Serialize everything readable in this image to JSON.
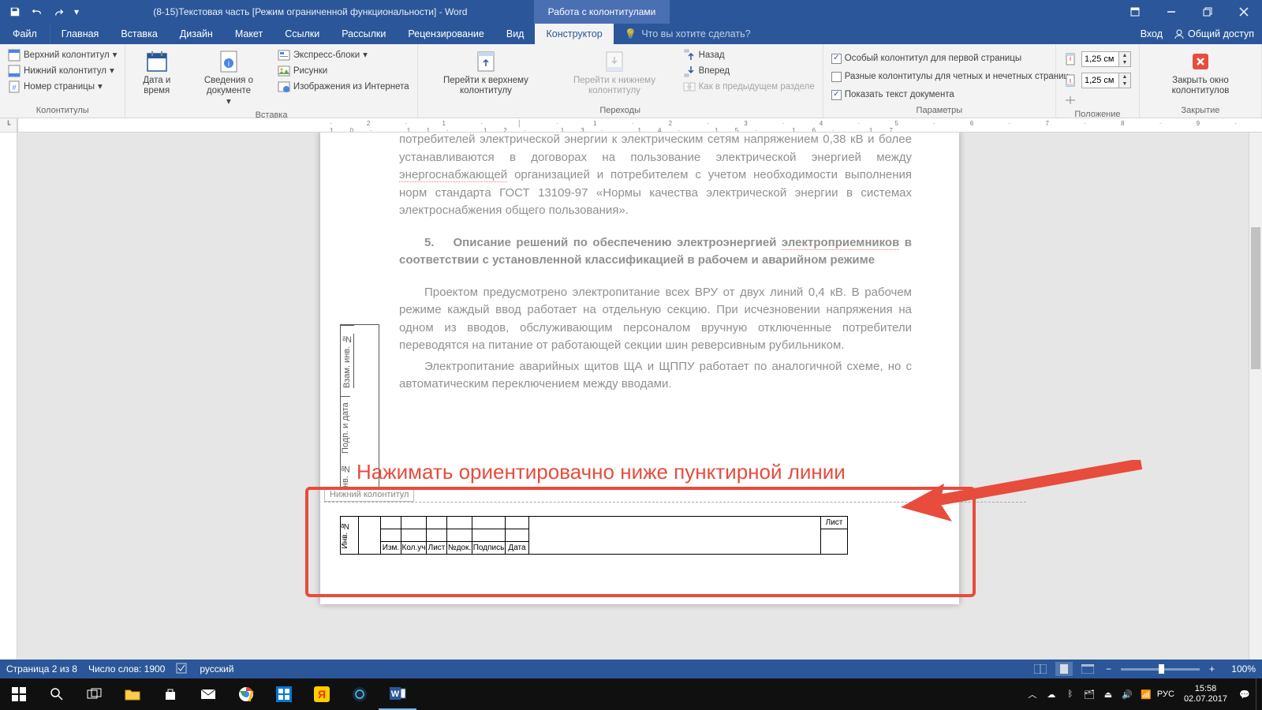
{
  "titlebar": {
    "doc_title": "(8-15)Текстовая часть [Режим ограниченной функциональности] - Word",
    "tool_tab": "Работа с колонтитулами"
  },
  "tabs": {
    "file": "Файл",
    "items": [
      "Главная",
      "Вставка",
      "Дизайн",
      "Макет",
      "Ссылки",
      "Рассылки",
      "Рецензирование",
      "Вид",
      "Конструктор"
    ],
    "active": "Конструктор",
    "tell_me": "Что вы хотите сделать?",
    "sign_in": "Вход",
    "share": "Общий доступ"
  },
  "ribbon": {
    "g1": {
      "header_top": "Верхний колонтитул",
      "header_bot": "Нижний колонтитул",
      "page_num": "Номер страницы",
      "label": "Колонтитулы"
    },
    "g2": {
      "date": "Дата и время",
      "docinfo": "Сведения о документе",
      "express": "Экспресс-блоки",
      "pictures": "Рисунки",
      "online_pics": "Изображения из Интернета",
      "label": "Вставка"
    },
    "g3": {
      "goto_header": "Перейти к верхнему колонтитулу",
      "goto_footer": "Перейти к нижнему колонтитулу",
      "prev": "Назад",
      "next": "Вперед",
      "link_prev": "Как в предыдущем разделе",
      "label": "Переходы"
    },
    "g4": {
      "diff_first": "Особый колонтитул для первой страницы",
      "diff_odd": "Разные колонтитулы для четных и нечетных страниц",
      "show_doc": "Показать текст документа",
      "label": "Параметры"
    },
    "g5": {
      "top_val": "1,25 см",
      "bot_val": "1,25 см",
      "label": "Положение"
    },
    "g6": {
      "close": "Закрыть окно колонтитулов",
      "label": "Закрытие"
    }
  },
  "document": {
    "para1_a": "потребителей электрической энергии к электрическим сетям напряжением 0,38 кВ и более устанавливаются в договорах на пользование электрической энергией между ",
    "para1_u": "энергоснабжающей",
    "para1_b": " организацией и потребителем с учетом необходимости выполнения норм стандарта ГОСТ 13109-97 «Нормы качества электрической энергии в системах электроснабжения общего пользования».",
    "heading_num": "5.",
    "heading_a": "Описание решений по обеспечению электроэнергией ",
    "heading_u": "электроприемников",
    "heading_b": " в соответствии с установленной классификацией в рабочем и аварийном режиме",
    "para3": "Проектом предусмотрено электропитание всех ВРУ от двух линий 0,4 кВ. В рабочем режиме каждый ввод работает на отдельную секцию. При исчезновении напряжения на одном из вводов, обслуживающим персоналом вручную отключенные потребители переводятся на питание от работающей секции шин реверсивным рубильником.",
    "para4": "Электропитание аварийных щитов ЩА и ЩППУ работает по аналогичной схеме, но с автоматическим переключением между вводами.",
    "side_labels": [
      "Взам. инв. №",
      "Подп. и дата",
      "Инв. №"
    ],
    "footer_tag": "Нижний колонтитул",
    "stamp_headers": [
      "Изм.",
      "Кол.уч",
      "Лист",
      "№док.",
      "Подпись",
      "Дата"
    ],
    "stamp_right": "Лист"
  },
  "annotation": {
    "text": "Нажимать ориентировачно ниже пунктирной линии"
  },
  "statusbar": {
    "page": "Страница 2 из 8",
    "words": "Число слов: 1900",
    "lang": "русский",
    "zoom": "100%"
  },
  "taskbar": {
    "lang": "РУС",
    "time": "15:58",
    "date": "02.07.2017"
  }
}
